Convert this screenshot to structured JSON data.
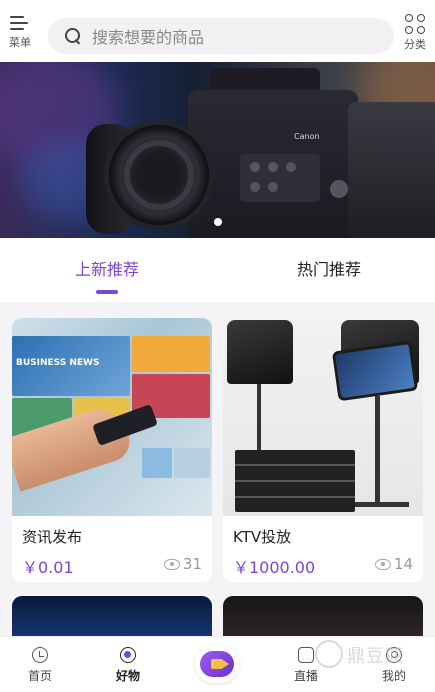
{
  "header": {
    "menu_label": "菜单",
    "category_label": "分类",
    "search_placeholder": "搜索想要的商品"
  },
  "banner": {
    "camera_brand": "Canon",
    "slide_count": 2,
    "active_slide": 1
  },
  "tabs": [
    {
      "label": "上新推荐",
      "active": true
    },
    {
      "label": "热门推荐",
      "active": false
    }
  ],
  "products": [
    {
      "title": "资讯发布",
      "price": "￥0.01",
      "views": "31",
      "image_text": "BUSINESS NEWS"
    },
    {
      "title": "KTV投放",
      "price": "￥1000.00",
      "views": "14"
    }
  ],
  "bottom_nav": {
    "items": [
      {
        "label": "首页",
        "icon": "home-icon"
      },
      {
        "label": "好物",
        "icon": "goods-icon",
        "active": true
      },
      {
        "label": "",
        "icon": "live-video-icon"
      },
      {
        "label": "直播",
        "icon": "live-icon"
      },
      {
        "label": "我的",
        "icon": "profile-icon"
      }
    ]
  },
  "watermark": {
    "text": "鼎豆亚"
  },
  "colors": {
    "accent": "#7b45d6",
    "background": "#f4f4f6"
  }
}
